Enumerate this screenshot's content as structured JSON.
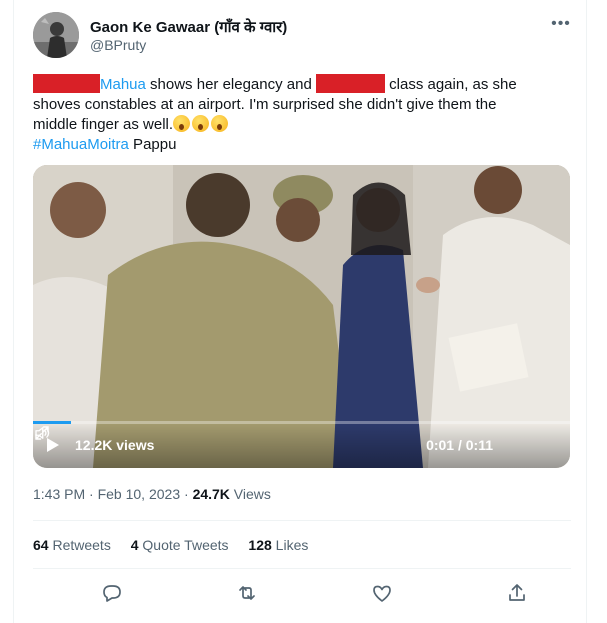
{
  "author": {
    "name": "Gaon Ke Gawaar (गाँव के ग्वार)",
    "handle": "@BPruty"
  },
  "tweet": {
    "line1_mention": "Mahua",
    "line1_text_a": " shows her elegancy and ",
    "line1_text_b": " class again, as she",
    "line2": "shoves constables at an airport. I'm surprised she didn't give them the",
    "line3": "middle finger as well.",
    "hashtag": "#MahuaMoitra",
    "trailing_word": " Pappu"
  },
  "video": {
    "views_label": "12.2K views",
    "time_label": "0:01 / 0:11",
    "progress": 0.07
  },
  "meta": {
    "time": "1:43 PM",
    "separator1": " · ",
    "date": "Feb 10, 2023",
    "separator2": " · ",
    "views_count": "24.7K",
    "views_word": " Views"
  },
  "stats": {
    "retweets_count": "64",
    "retweets_label": " Retweets",
    "quotes_count": "4",
    "quotes_label": " Quote Tweets",
    "likes_count": "128",
    "likes_label": " Likes"
  },
  "icons": {
    "more": "more-horizontal-icon",
    "reply": "reply-icon",
    "retweet": "retweet-icon",
    "like": "heart-icon",
    "share": "share-icon"
  },
  "colors": {
    "link": "#1d9bf0",
    "redaction": "#d92027",
    "secondary_text": "#536471"
  }
}
